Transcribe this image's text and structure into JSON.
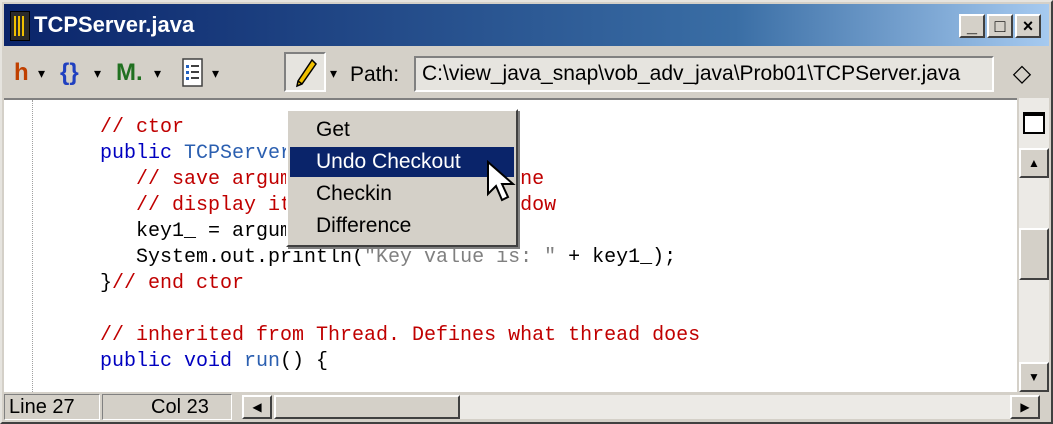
{
  "window": {
    "title": "TCPServer.java"
  },
  "caption_buttons": {
    "minimize": "_",
    "maximize": "□",
    "close": "×"
  },
  "toolbar": {
    "path_label": "Path:",
    "path_value": "C:\\view_java_snap\\vob_adv_java\\Prob01\\TCPServer.java",
    "buttons": [
      {
        "name": "h-icon",
        "glyph": "h"
      },
      {
        "name": "braces-icon",
        "glyph": "{}"
      },
      {
        "name": "m-icon",
        "glyph": "M."
      },
      {
        "name": "document-list-icon",
        "glyph": ""
      },
      {
        "name": "pencil-icon",
        "glyph": ""
      }
    ],
    "dropdown_glyph": "▾",
    "diamond_glyph": "◇"
  },
  "menu": {
    "items": [
      "Get",
      "Undo Checkout",
      "Checkin",
      "Difference"
    ],
    "selected": "Undo Checkout"
  },
  "code": {
    "lines": [
      "// ctor",
      "public TCPServer(int argument) {",
      "   // save argument from command line",
      "   // display it in the console window",
      "   key1_ = argument;",
      "   System.out.println(\"Key value is: \" + key1_);",
      "}// end ctor",
      "",
      "// inherited from Thread. Defines what thread does",
      "public void run() {"
    ]
  },
  "status": {
    "line": "Line 27",
    "col": "Col 23"
  },
  "colors": {
    "title_bar": "#0a246a",
    "comment": "#c00000",
    "menu_highlight": "#0a246a"
  }
}
